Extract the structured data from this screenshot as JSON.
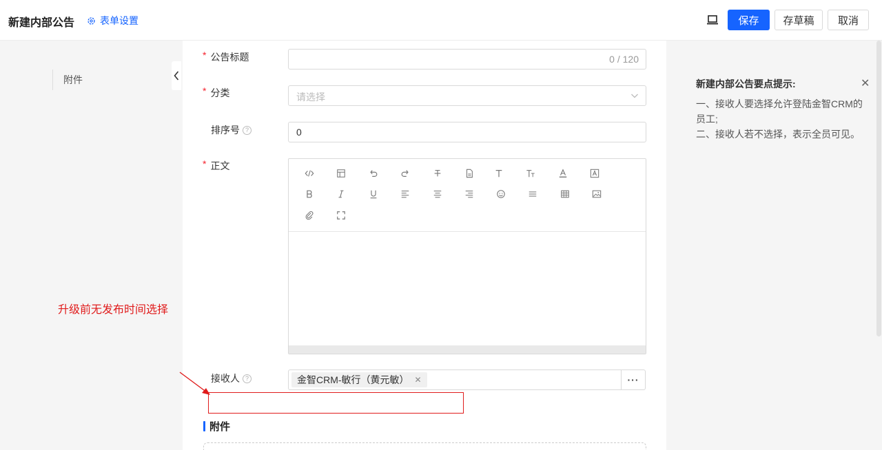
{
  "header": {
    "title": "新建内部公告",
    "form_settings_label": "表单设置",
    "save_label": "保存",
    "draft_label": "存草稿",
    "cancel_label": "取消"
  },
  "sidebar": {
    "items": [
      {
        "label": "附件"
      }
    ]
  },
  "form": {
    "title_field": {
      "label": "公告标题",
      "counter": "0 / 120",
      "required": true
    },
    "category_field": {
      "label": "分类",
      "placeholder": "请选择",
      "required": true
    },
    "sort_field": {
      "label": "排序号",
      "value": "0",
      "help": "?"
    },
    "content_field": {
      "label": "正文",
      "required": true
    },
    "recipient_field": {
      "label": "接收人",
      "help": "?",
      "tags": [
        "金智CRM-敏行（黄元敏）"
      ],
      "more_label": "···"
    },
    "attachment_section": {
      "title": "附件"
    }
  },
  "editor_toolbar": {
    "icons": [
      "code-icon",
      "template-icon",
      "undo-icon",
      "redo-icon",
      "strikethrough-icon",
      "document-icon",
      "text-icon",
      "font-size-icon",
      "font-color-icon",
      "background-color-icon",
      "bold-icon",
      "italic-icon",
      "underline-icon",
      "align-left-icon",
      "align-center-icon",
      "align-right-icon",
      "emoji-icon",
      "line-height-icon",
      "table-icon",
      "image-icon",
      "attachment-icon",
      "fullscreen-icon"
    ]
  },
  "annotation": {
    "text": "升级前无发布时间选择",
    "color": "#e01b1b"
  },
  "tips": {
    "title": "新建内部公告要点提示:",
    "lines": [
      "一、接收人要选择允许登陆金智CRM的员工;",
      "二、接收人若不选择，表示全员可见。"
    ]
  },
  "colors": {
    "primary": "#1664ff",
    "required": "#f5222d",
    "annotation": "#e01b1b"
  }
}
